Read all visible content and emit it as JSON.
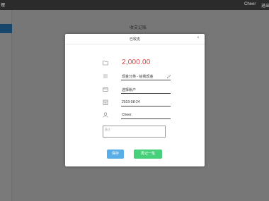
{
  "topbar": {
    "menu_left": "理",
    "user": "Cheer",
    "logout": "退出"
  },
  "page": {
    "title": "收支记账"
  },
  "modal": {
    "title": "已收支",
    "close": "×",
    "amount": "2,000.00",
    "account_flow": "现金分类 - 给我现金",
    "account": "选择账户",
    "date": "2019-08-24",
    "user": "Cheer",
    "note_placeholder": "备注",
    "save_label": "保存",
    "again_label": "再记一笔"
  },
  "icons": {
    "amount": "folder-icon",
    "category": "list-icon",
    "account": "card-icon",
    "date": "calendar-icon",
    "user": "user-icon",
    "edit": "edit-icon"
  },
  "colors": {
    "amount": "#e03b3b",
    "save_button": "#5aaee8",
    "again_button": "#47d07a",
    "sidebar_active": "#2e8cd8"
  }
}
